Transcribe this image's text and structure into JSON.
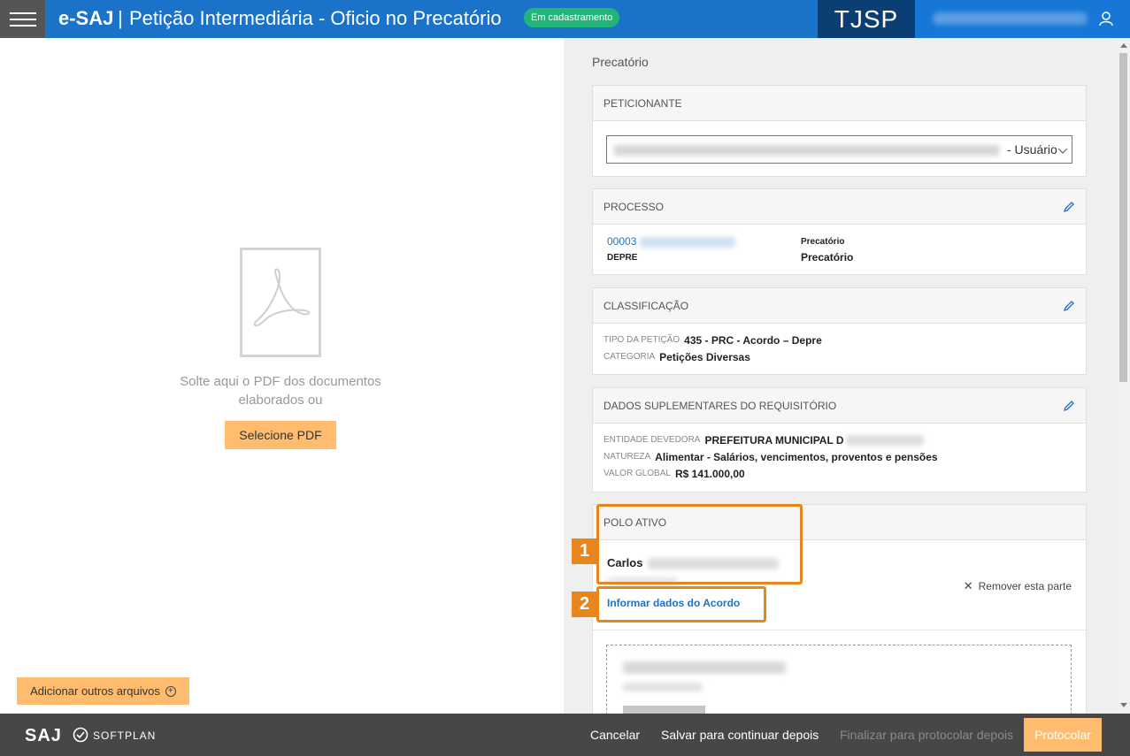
{
  "header": {
    "brand": "e-SAJ",
    "separator": "|",
    "title": "Petição Intermediária - Oficio no Precatório",
    "status_badge": "Em cadastramento",
    "court": "TJSP"
  },
  "left": {
    "drop_text": "Solte aqui o PDF dos documentos elaborados ou",
    "select_pdf_label": "Selecione PDF",
    "add_files_label": "Adicionar outros arquivos",
    "add_files_icon": "plus-circle-icon"
  },
  "right": {
    "section_title": "Precatório",
    "peticionante": {
      "header": "PETICIONANTE",
      "select_value_suffix": "- Usuário"
    },
    "processo": {
      "header": "PROCESSO",
      "number_prefix": "00003",
      "court_unit": "DEPRE",
      "class_label": "Precatório",
      "class_value": "Precatório"
    },
    "classificacao": {
      "header": "CLASSIFICAÇÃO",
      "tipo_label": "TIPO DA PETIÇÃO",
      "tipo_value": "435 - PRC - Acordo – Depre",
      "categoria_label": "CATEGORIA",
      "categoria_value": "Petições Diversas"
    },
    "dados_suplementares": {
      "header": "DADOS SUPLEMENTARES DO REQUISITÓRIO",
      "entidade_label": "ENTIDADE DEVEDORA",
      "entidade_value": "PREFEITURA MUNICIPAL D",
      "natureza_label": "NATUREZA",
      "natureza_value": "Alimentar - Salários, vencimentos, proventos e pensões",
      "valor_label": "VALOR GLOBAL",
      "valor_value": "R$ 141.000,00"
    },
    "polo_ativo": {
      "header": "POLO ATIVO",
      "party_name": "Carlos",
      "remove_label": "Remover esta parte",
      "inform_link": "Informar dados do Acordo"
    },
    "callouts": [
      "1",
      "2"
    ]
  },
  "footer": {
    "logo": "SAJ",
    "softplan": "SOFTPLAN",
    "cancel": "Cancelar",
    "save_later": "Salvar para continuar depois",
    "finalize": "Finalizar para protocolar depois",
    "protocolar": "Protocolar"
  },
  "colors": {
    "header_blue": "#1a72c9",
    "court_navy": "#0b3f73",
    "badge_green": "#21b57a",
    "button_orange": "#ffbc6e",
    "callout_orange": "#e8851c",
    "footer_gray": "#474747"
  }
}
